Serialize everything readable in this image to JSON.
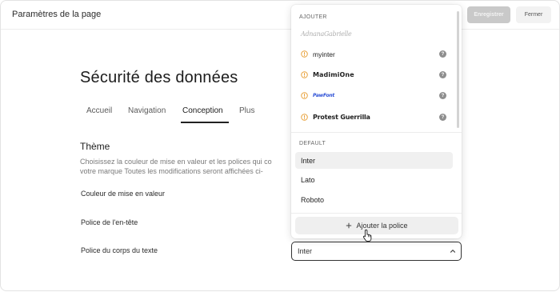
{
  "header": {
    "title": "Paramètres de la page",
    "save_label": "Enregistrer",
    "close_label": "Fermer"
  },
  "page": {
    "title": "Sécurité des données"
  },
  "tabs": [
    {
      "label": "Accueil"
    },
    {
      "label": "Navigation"
    },
    {
      "label": "Conception"
    },
    {
      "label": "Plus"
    }
  ],
  "theme": {
    "title": "Thème",
    "description_line1": "Choisissez la couleur de mise en valeur et les polices qui co",
    "description_line2": "votre marque Toutes les modifications seront affichées ci-"
  },
  "fields": {
    "accent_color_label": "Couleur de mise en valeur",
    "heading_font_label": "Police de l'en-tête",
    "body_font_label": "Police du corps du texte",
    "body_font_value": "Inter"
  },
  "dropdown": {
    "add_group_label": "AJOUTER",
    "handwritten_preview": "AdnanaGabrielle",
    "custom_fonts": [
      {
        "label": "myinter"
      },
      {
        "label": "MadimiOne"
      },
      {
        "label": "PawFont"
      },
      {
        "label": "Protest Guerrilla"
      }
    ],
    "info_symbol": "?",
    "default_group_label": "DEFAULT",
    "default_fonts": [
      {
        "label": "Inter",
        "selected": true
      },
      {
        "label": "Lato",
        "selected": false
      },
      {
        "label": "Roboto",
        "selected": false
      }
    ],
    "add_font_label": "Ajouter la police"
  },
  "colors": {
    "warning": "#e8a13a",
    "info_badge": "#8e8e8e",
    "save_disabled": "#c9c9c9"
  },
  "icons": {
    "warning": "warning-circle-icon",
    "info": "question-badge-icon",
    "chevron": "chevron-up-icon",
    "plus": "plus-icon",
    "cursor": "hand-pointer-icon"
  }
}
